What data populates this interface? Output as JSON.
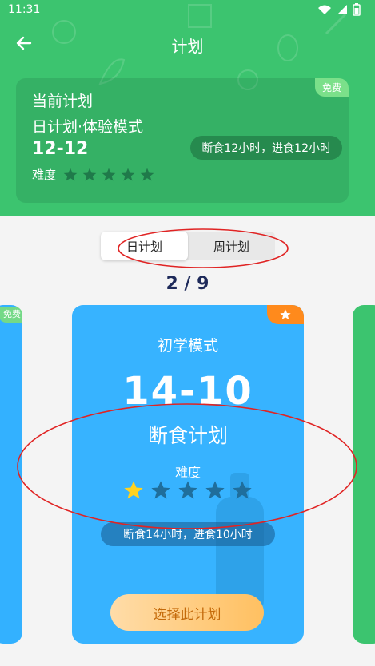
{
  "status_bar": {
    "time": "11:31"
  },
  "header": {
    "title": "计划"
  },
  "current_plan": {
    "label": "当前计划",
    "plan_name": "日计划·体验模式",
    "time_ratio": "12-12",
    "difficulty_label": "难度",
    "difficulty_stars": 0,
    "description": "断食12小时，进食12小时",
    "badge": "免费"
  },
  "toggle": {
    "tabs": [
      "日计划",
      "周计划"
    ],
    "selected": "日计划"
  },
  "carousel": {
    "counter": "2 / 9",
    "left_card_badge": "免费",
    "card": {
      "mode": "初学模式",
      "time_ratio": "14-10",
      "plan_name": "断食计划",
      "difficulty_label": "难度",
      "difficulty_stars": 1,
      "description": "断食14小时，进食10小时",
      "button_label": "选择此计划"
    }
  },
  "colors": {
    "header_green": "#3cc46f",
    "card_blue": "#37b3ff",
    "star_gold": "#ffd21f",
    "star_dim": "#1f6e9c",
    "annotation_red": "#e02424"
  }
}
